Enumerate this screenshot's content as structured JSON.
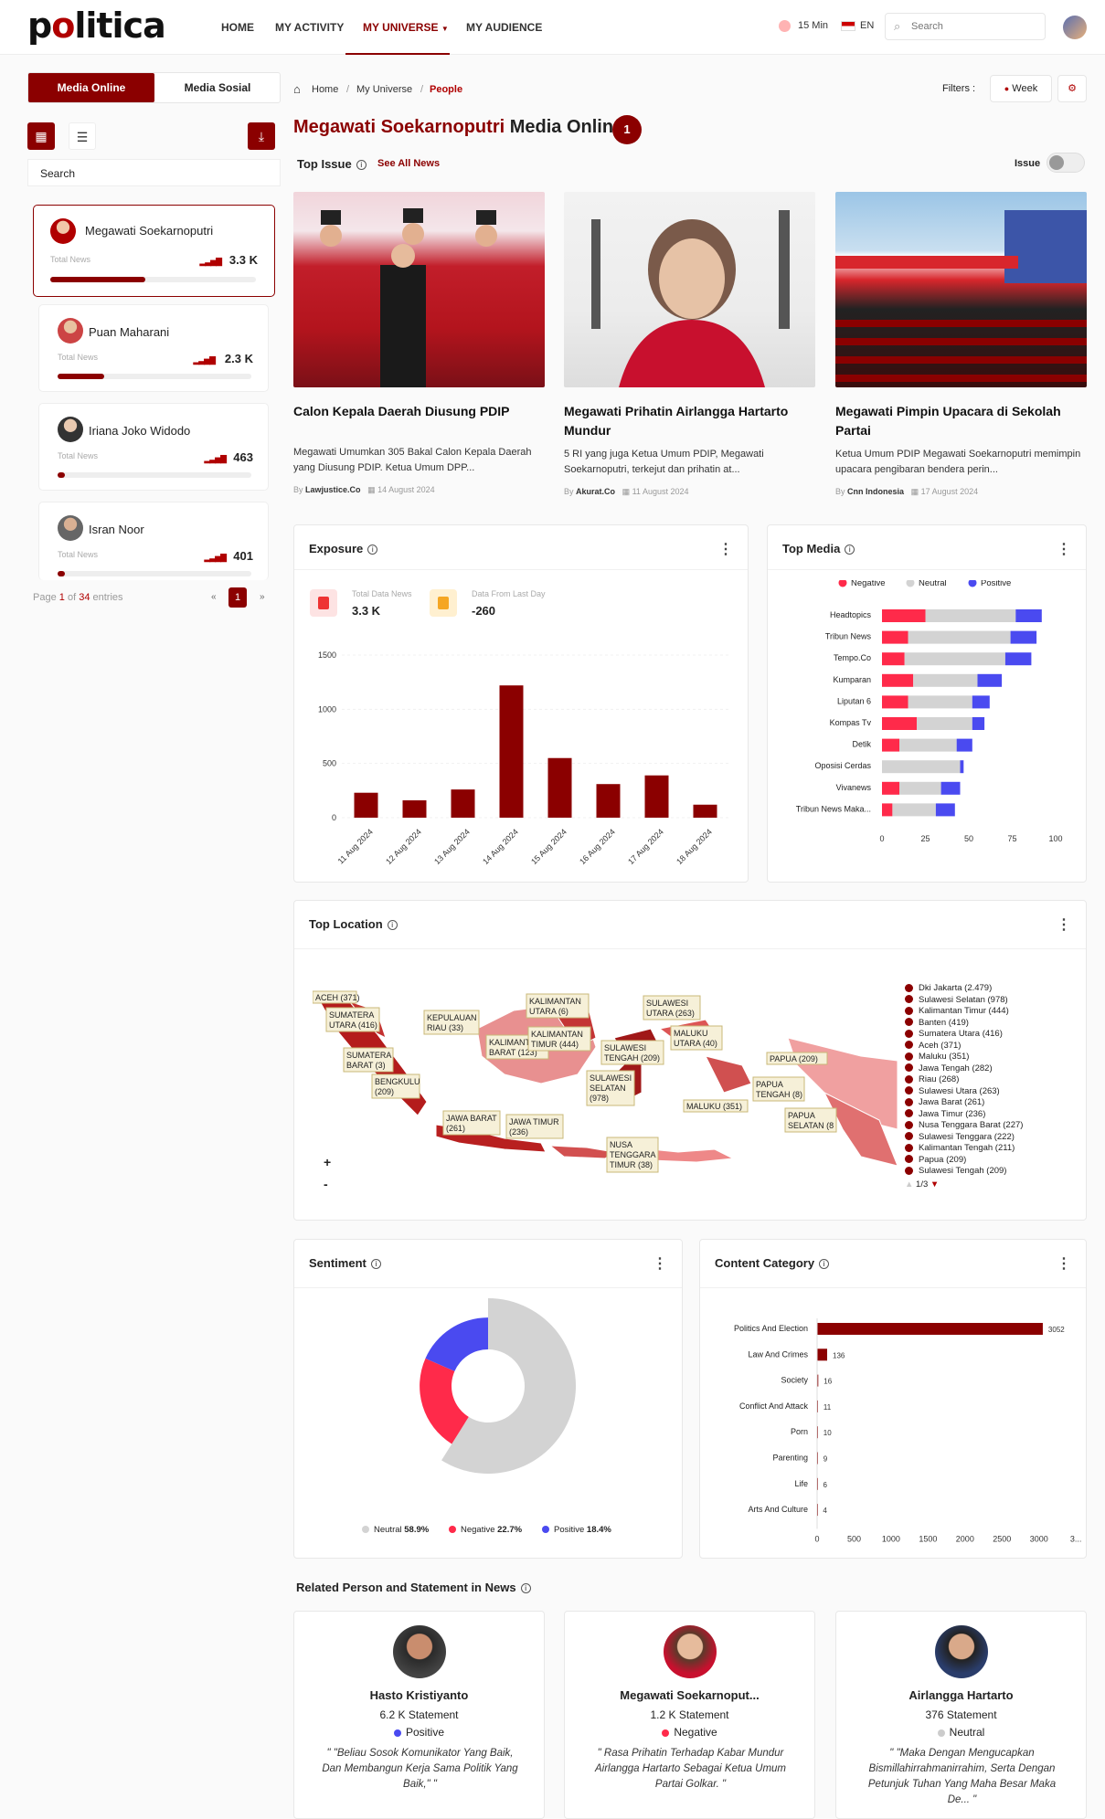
{
  "header": {
    "logo": "politica",
    "nav": [
      "HOME",
      "MY ACTIVITY",
      "MY UNIVERSE",
      "MY AUDIENCE"
    ],
    "refresh": "15 Min",
    "lang": "EN",
    "search_placeholder": "Search"
  },
  "sidebar": {
    "tabs": [
      "Media Online",
      "Media Sosial"
    ],
    "search_label": "Search",
    "people": [
      {
        "name": "Megawati Soekarnoputri",
        "label": "Total News",
        "value": "3.3 K",
        "fill": 0.46
      },
      {
        "name": "Puan Maharani",
        "label": "Total News",
        "value": "2.3 K",
        "fill": 0.24
      },
      {
        "name": "Iriana Joko Widodo",
        "label": "Total News",
        "value": "463",
        "fill": 0.04
      },
      {
        "name": "Isran Noor",
        "label": "Total News",
        "value": "401",
        "fill": 0.04
      }
    ],
    "pager": {
      "prefix": "Page",
      "page": "1",
      "of": "of",
      "total": "34",
      "suffix": "entries",
      "prev": "«",
      "next": "»"
    }
  },
  "breadcrumb": [
    "Home",
    "My Universe",
    "People"
  ],
  "filters": {
    "label": "Filters :",
    "period": "Week"
  },
  "headline": {
    "name": "Megawati Soekarnoputri",
    "section": "Media Online",
    "badge": "1"
  },
  "top_issue": {
    "title": "Top Issue",
    "see_all": "See All News",
    "issue_label": "Issue"
  },
  "news": [
    {
      "title": "Calon Kepala Daerah Diusung PDIP",
      "desc": "Megawati Umumkan 305 Bakal Calon Kepala Daerah yang Diusung PDIP. Ketua Umum DPP...",
      "by": "By",
      "source": "Lawjustice.Co",
      "date": "14 August 2024"
    },
    {
      "title": "Megawati Prihatin Airlangga Hartarto Mundur",
      "desc": "5 RI yang juga Ketua Umum PDIP, Megawati Soekarnoputri, terkejut dan prihatin at...",
      "by": "By",
      "source": "Akurat.Co",
      "date": "11 August 2024"
    },
    {
      "title": "Megawati Pimpin Upacara di Sekolah Partai",
      "desc": "Ketua Umum PDIP Megawati Soekarnoputri memimpin upacara pengibaran bendera perin...",
      "by": "By",
      "source": "Cnn Indonesia",
      "date": "17 August 2024"
    }
  ],
  "exposure": {
    "title": "Exposure",
    "total_label": "Total Data News",
    "total_value": "3.3 K",
    "delta_label": "Data From Last Day",
    "delta_value": "-260"
  },
  "top_media": {
    "title": "Top Media"
  },
  "top_location": {
    "title": "Top Location",
    "legend": [
      "Dki Jakarta (2.479)",
      "Sulawesi Selatan (978)",
      "Kalimantan Timur (444)",
      "Banten (419)",
      "Sumatera Utara (416)",
      "Aceh (371)",
      "Maluku (351)",
      "Jawa Tengah (282)",
      "Riau (268)",
      "Sulawesi Utara (263)",
      "Jawa Barat (261)",
      "Jawa Timur (236)",
      "Nusa Tenggara Barat (227)",
      "Sulawesi Tenggara (222)",
      "Kalimantan Tengah (211)",
      "Papua (209)",
      "Sulawesi Tengah (209)"
    ],
    "legend_page": "1/3",
    "map_labels": [
      "ACEH (371)",
      "SUMATERA UTARA (416)",
      "SUMATERA BARAT (3)",
      "BENGKULU (209)",
      "KEPULAUAN RIAU (33)",
      "KALIMANTAN UTARA (6)",
      "KALIMANTAN BARAT (123)",
      "KALIMANTAN TIMUR (444)",
      "SULAWESI UTARA (263)",
      "MALUKU UTARA (40)",
      "SULAWESI TENGAH (209)",
      "SULAWESI SELATAN (978)",
      "JAWA BARAT (261)",
      "JAWA TIMUR (236)",
      "NUSA TENGGARA TIMUR (38)",
      "MALUKU (351)",
      "PAPUA (209)",
      "PAPUA TENGAH (8)",
      "PAPUA SELATAN (8"
    ],
    "zoom_in": "+",
    "zoom_out": "-"
  },
  "sentiment": {
    "title": "Sentiment",
    "legend": [
      {
        "label": "Neutral",
        "pct": "58.9%",
        "color": "#d3d3d3"
      },
      {
        "label": "Negative",
        "pct": "22.7%",
        "color": "#ff2a4a"
      },
      {
        "label": "Positive",
        "pct": "18.4%",
        "color": "#4a4af0"
      }
    ]
  },
  "content_category": {
    "title": "Content Category"
  },
  "related": {
    "title": "Related Person and Statement in News",
    "people": [
      {
        "name": "Hasto Kristiyanto",
        "statement": "6.2 K Statement",
        "sentiment": "Positive",
        "color": "#4a4af0",
        "quote": "\" \"Beliau Sosok Komunikator Yang Baik, Dan Membangun Kerja Sama Politik Yang Baik,\" \""
      },
      {
        "name": "Megawati Soekarnoput...",
        "statement": "1.2 K Statement",
        "sentiment": "Negative",
        "color": "#ff2a4a",
        "quote": "\" Rasa Prihatin Terhadap Kabar Mundur Airlangga Hartarto Sebagai Ketua Umum Partai Golkar. \""
      },
      {
        "name": "Airlangga Hartarto",
        "statement": "376 Statement",
        "sentiment": "Neutral",
        "color": "#cccccc",
        "quote": "\" \"Maka Dengan Mengucapkan Bismillahirrahmanirrahim, Serta Dengan Petunjuk Tuhan Yang Maha Besar Maka De... \""
      }
    ]
  },
  "chart_data": [
    {
      "type": "bar",
      "title": "Exposure",
      "categories": [
        "11 Aug 2024",
        "12 Aug 2024",
        "13 Aug 2024",
        "14 Aug 2024",
        "15 Aug 2024",
        "16 Aug 2024",
        "17 Aug 2024",
        "18 Aug 2024"
      ],
      "values": [
        230,
        160,
        260,
        1220,
        550,
        310,
        390,
        120
      ],
      "yticks": [
        0,
        500,
        1000,
        1500
      ],
      "ylim": [
        0,
        1500
      ],
      "color": "#8b0000"
    },
    {
      "type": "bar",
      "orientation": "horizontal-stacked",
      "title": "Top Media",
      "categories": [
        "Headtopics",
        "Tribun News",
        "Tempo.Co",
        "Kumparan",
        "Liputan 6",
        "Kompas Tv",
        "Detik",
        "Oposisi Cerdas",
        "Vivanews",
        "Tribun News Maka..."
      ],
      "series": [
        {
          "name": "Negative",
          "color": "#ff2a4a",
          "values": [
            25,
            15,
            13,
            18,
            15,
            20,
            10,
            0,
            10,
            6
          ]
        },
        {
          "name": "Neutral",
          "color": "#d3d3d3",
          "values": [
            52,
            59,
            58,
            37,
            37,
            32,
            33,
            45,
            24,
            25
          ]
        },
        {
          "name": "Positive",
          "color": "#4a4af0",
          "values": [
            15,
            15,
            15,
            14,
            10,
            7,
            9,
            2,
            11,
            11
          ]
        }
      ],
      "xticks": [
        0,
        25,
        50,
        75,
        100
      ],
      "xlim": [
        0,
        100
      ]
    },
    {
      "type": "pie",
      "title": "Sentiment",
      "labels": [
        "Neutral",
        "Negative",
        "Positive"
      ],
      "values": [
        58.9,
        22.7,
        18.4
      ],
      "colors": [
        "#d3d3d3",
        "#ff2a4a",
        "#4a4af0"
      ]
    },
    {
      "type": "bar",
      "orientation": "horizontal",
      "title": "Content Category",
      "categories": [
        "Politics And Election",
        "Law And Crimes",
        "Society",
        "Conflict And Attack",
        "Porn",
        "Parenting",
        "Life",
        "Arts And Culture"
      ],
      "values": [
        3052,
        136,
        16,
        11,
        10,
        9,
        6,
        4
      ],
      "xticks": [
        "0",
        "500",
        "1000",
        "1500",
        "2000",
        "2500",
        "3000",
        "3..."
      ],
      "xlim": [
        0,
        3300
      ],
      "color": "#8b0000"
    }
  ]
}
